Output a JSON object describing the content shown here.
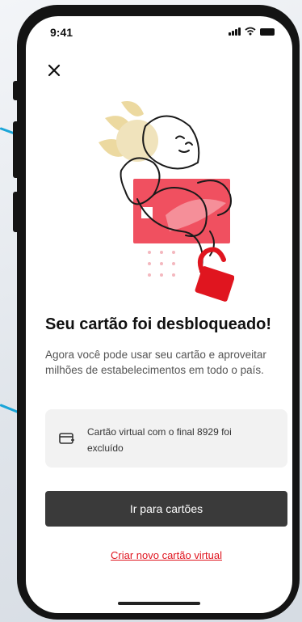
{
  "status_bar": {
    "time": "9:41"
  },
  "icons": {
    "close": "close-icon",
    "signal": "signal-icon",
    "wifi": "wifi-icon",
    "battery": "battery-icon",
    "card": "card-icon",
    "illustration": "unlocked-card-illustration"
  },
  "colors": {
    "accent": "#e0151f",
    "card": "#f05060",
    "primary_button": "#3a3a3a"
  },
  "main": {
    "title": "Seu cartão foi desbloqueado!",
    "subtitle": "Agora você pode usar seu cartão e aproveitar milhões de estabelecimentos em todo o país.",
    "info_text": "Cartão virtual com o final 8929 foi excluído",
    "primary_button": "Ir para cartões",
    "secondary_link": "Criar novo cartão virtual"
  }
}
